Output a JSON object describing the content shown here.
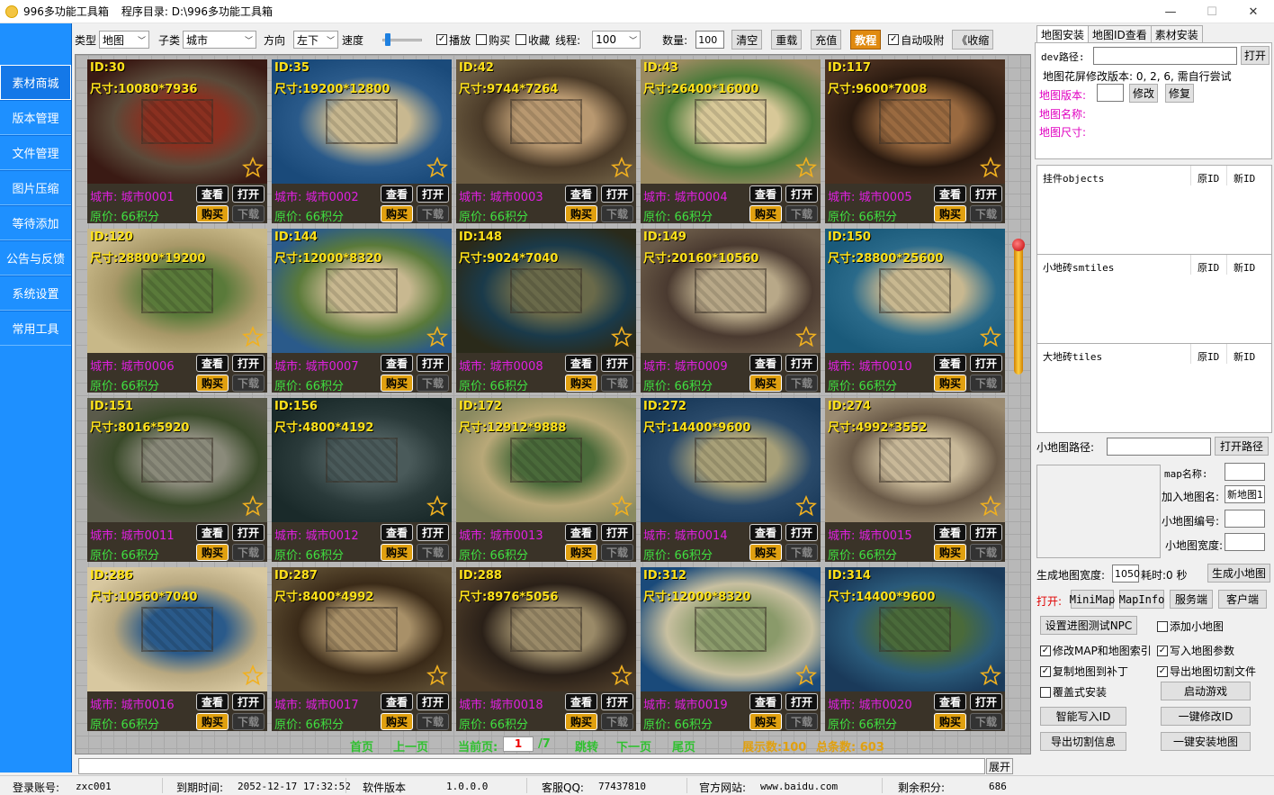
{
  "window": {
    "title": "996多功能工具箱",
    "dir_label": "程序目录: ",
    "dir_path": "D:\\996多功能工具箱"
  },
  "sidebar": {
    "items": [
      {
        "label": "素材商城",
        "active": true
      },
      {
        "label": "版本管理"
      },
      {
        "label": "文件管理"
      },
      {
        "label": "图片压缩"
      },
      {
        "label": "等待添加"
      },
      {
        "label": "公告与反馈"
      },
      {
        "label": "系统设置"
      },
      {
        "label": "常用工具"
      }
    ]
  },
  "toolbar": {
    "type_label": "类型",
    "type_value": "地图",
    "subtype_label": "子类",
    "subtype_value": "城市",
    "dir_label": "方向",
    "dir_value": "左下",
    "speed_label": "速度",
    "play_label": "播放",
    "play_checked": true,
    "bought_label": "购买",
    "bought_checked": false,
    "fav_label": "收藏",
    "fav_checked": false,
    "thread_label": "线程:",
    "thread_value": "100",
    "count_label": "数量:",
    "count_value": "100",
    "clear_label": "清空",
    "reload_label": "重载",
    "recharge_label": "充值",
    "tutorial_label": "教程",
    "autosnap_label": "自动吸附",
    "autosnap_checked": true,
    "collapse_label": "《收缩"
  },
  "card_labels": {
    "city_prefix": "城市: ",
    "price_prefix": "原价: ",
    "view": "查看",
    "open": "打开",
    "buy": "购买",
    "download": "下载"
  },
  "cards": [
    {
      "id": "ID:30",
      "size": "尺寸:10080*7936",
      "city": "城市0001",
      "price": "66积分",
      "palette": [
        "#3a1a14",
        "#8a3020",
        "#5a4a3a"
      ]
    },
    {
      "id": "ID:35",
      "size": "尺寸:19200*12800",
      "city": "城市0002",
      "price": "66积分",
      "palette": [
        "#1a4a7a",
        "#c8b890",
        "#2a5a8a"
      ]
    },
    {
      "id": "ID:42",
      "size": "尺寸:9744*7264",
      "city": "城市0003",
      "price": "66积分",
      "palette": [
        "#6a5a40",
        "#b89870",
        "#4a3a28"
      ]
    },
    {
      "id": "ID:43",
      "size": "尺寸:26400*16000",
      "city": "城市0004",
      "price": "66积分",
      "palette": [
        "#9a8a60",
        "#d8c898",
        "#4a7a3a"
      ]
    },
    {
      "id": "ID:117",
      "size": "尺寸:9600*7008",
      "city": "城市0005",
      "price": "66积分",
      "palette": [
        "#4a3020",
        "#9a6a40",
        "#2a1a10"
      ]
    },
    {
      "id": "ID:120",
      "size": "尺寸:28800*19200",
      "city": "城市0006",
      "price": "66积分",
      "palette": [
        "#c8b888",
        "#5a7a3a",
        "#a89868"
      ]
    },
    {
      "id": "ID:144",
      "size": "尺寸:12000*8320",
      "city": "城市0007",
      "price": "66积分",
      "palette": [
        "#2a5a8a",
        "#c8b890",
        "#5a7a3a"
      ]
    },
    {
      "id": "ID:148",
      "size": "尺寸:9024*7040",
      "city": "城市0008",
      "price": "66积分",
      "palette": [
        "#2a2a1a",
        "#6a6a4a",
        "#1a3a4a"
      ]
    },
    {
      "id": "ID:149",
      "size": "尺寸:20160*10560",
      "city": "城市0009",
      "price": "66积分",
      "palette": [
        "#6a5a48",
        "#b8a888",
        "#4a3a30"
      ]
    },
    {
      "id": "ID:150",
      "size": "尺寸:28800*25600",
      "city": "城市0010",
      "price": "66积分",
      "palette": [
        "#1a5a7a",
        "#c8b890",
        "#2a6a8a"
      ]
    },
    {
      "id": "ID:151",
      "size": "尺寸:8016*5920",
      "city": "城市0011",
      "price": "66积分",
      "palette": [
        "#5a5a4a",
        "#8a8a7a",
        "#3a4a2a"
      ]
    },
    {
      "id": "ID:156",
      "size": "尺寸:4800*4192",
      "city": "城市0012",
      "price": "66积分",
      "palette": [
        "#1a2a2a",
        "#4a5a5a",
        "#2a3a3a"
      ]
    },
    {
      "id": "ID:172",
      "size": "尺寸:12912*9888",
      "city": "城市0013",
      "price": "66积分",
      "palette": [
        "#8a8a60",
        "#4a6a3a",
        "#b8a878"
      ]
    },
    {
      "id": "ID:272",
      "size": "尺寸:14400*9600",
      "city": "城市0014",
      "price": "66积分",
      "palette": [
        "#1a3a5a",
        "#a8a078",
        "#2a4a6a"
      ]
    },
    {
      "id": "ID:274",
      "size": "尺寸:4992*3552",
      "city": "城市0015",
      "price": "66积分",
      "palette": [
        "#9a8a70",
        "#c8b898",
        "#6a5a48"
      ]
    },
    {
      "id": "ID:286",
      "size": "尺寸:10560*7040",
      "city": "城市0016",
      "price": "66积分",
      "palette": [
        "#d8c8a0",
        "#2a5a8a",
        "#b8a880"
      ]
    },
    {
      "id": "ID:287",
      "size": "尺寸:8400*4992",
      "city": "城市0017",
      "price": "66积分",
      "palette": [
        "#5a4a30",
        "#a89068",
        "#3a2a18"
      ]
    },
    {
      "id": "ID:288",
      "size": "尺寸:8976*5056",
      "city": "城市0018",
      "price": "66积分",
      "palette": [
        "#4a3a28",
        "#9a8a68",
        "#2a2018"
      ]
    },
    {
      "id": "ID:312",
      "size": "尺寸:12000*8320",
      "city": "城市0019",
      "price": "66积分",
      "palette": [
        "#1a4a7a",
        "#8a9a6a",
        "#c8c0a0"
      ]
    },
    {
      "id": "ID:314",
      "size": "尺寸:14400*9600",
      "city": "城市0020",
      "price": "66积分",
      "palette": [
        "#1a3a5a",
        "#4a6a3a",
        "#2a5a7a"
      ]
    }
  ],
  "pager": {
    "first": "首页",
    "prev": "上一页",
    "current_label": "当前页:",
    "current": "1",
    "total": "/7",
    "jump": "跳转",
    "next": "下一页",
    "last": "尾页",
    "shown": "展示数:100",
    "total_count": "总条数: 603"
  },
  "expand_label": "展开",
  "status": {
    "account_label": "登录账号:",
    "account": "zxc001",
    "expire_label": "到期时间:",
    "expire": "2052-12-17 17:32:52",
    "version_label": "软件版本",
    "version": "1.0.0.0",
    "qq_label": "客服QQ:",
    "qq": "77437810",
    "site_label": "官方网站:",
    "site": "www.baidu.com",
    "points_label": "剩余积分:",
    "points": "686"
  },
  "right_panel": {
    "tabs": [
      "地图安装",
      "地图ID查看",
      "素材安装"
    ],
    "dev_label": "dev路径:",
    "dev_value": "",
    "open_btn": "打开",
    "hint": "地图花屏修改版本: 0, 2, 6, 需自行尝试",
    "map_version_label": "地图版本:",
    "map_version_value": "",
    "modify_btn": "修改",
    "restore_btn": "修复",
    "map_name_label": "地图名称:",
    "map_size_label": "地图尺寸:",
    "lists": [
      {
        "title": "挂件objects",
        "col1": "原ID",
        "col2": "新ID"
      },
      {
        "title": "小地砖smtiles",
        "col1": "原ID",
        "col2": "新ID"
      },
      {
        "title": "大地砖tiles",
        "col1": "原ID",
        "col2": "新ID"
      }
    ],
    "minimap_path_label": "小地图路径:",
    "minimap_path_value": "",
    "open_path_btn": "打开路径",
    "map_name2_label": "map名称:",
    "map_name2_value": "",
    "add_map_name_label": "加入地图名:",
    "add_map_name_value": "新地图1",
    "minimap_no_label": "小地图编号:",
    "minimap_no_value": "",
    "minimap_width_label": "小地图宽度:",
    "minimap_width_value": "",
    "gen_width_label": "生成地图宽度:",
    "gen_width_value": "1050",
    "elapsed": "耗时:0 秒",
    "gen_minimap_btn": "生成小地图",
    "open_label": "打开:",
    "minimap_btn": "MiniMap",
    "mapinfo_btn": "MapInfo",
    "server_btn": "服务端",
    "client_btn": "客户端",
    "set_npc_btn": "设置进图测试NPC",
    "add_minimap_label": "添加小地图",
    "add_minimap_checked": false,
    "modify_map_label": "修改MAP和地图索引",
    "modify_map_checked": true,
    "write_param_label": "写入地图参数",
    "write_param_checked": true,
    "copy_map_label": "复制地图到补丁",
    "copy_map_checked": true,
    "export_cut_label": "导出地图切割文件",
    "export_cut_checked": true,
    "overwrite_label": "覆盖式安装",
    "overwrite_checked": false,
    "start_game_btn": "启动游戏",
    "smart_write_btn": "智能写入ID",
    "one_modify_btn": "一键修改ID",
    "export_info_btn": "导出切割信息",
    "one_install_btn": "一键安装地图"
  }
}
